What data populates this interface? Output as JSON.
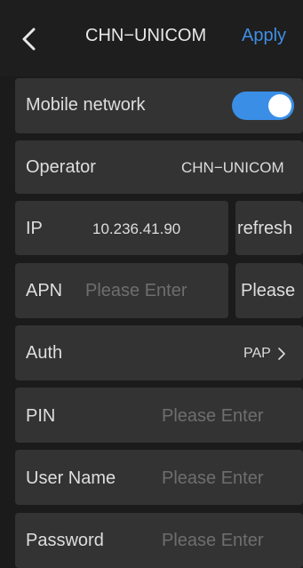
{
  "header": {
    "title": "CHN−UNICOM",
    "apply_label": "Apply"
  },
  "mobile_network": {
    "label": "Mobile network",
    "enabled": true
  },
  "operator": {
    "label": "Operator",
    "value": "CHN−UNICOM"
  },
  "ip": {
    "label": "IP",
    "value": "10.236.41.90",
    "refresh_label": "refresh"
  },
  "apn": {
    "label": "APN",
    "placeholder": "Please Enter",
    "side_placeholder": "Please"
  },
  "auth": {
    "label": "Auth",
    "value": "PAP"
  },
  "pin": {
    "label": "PIN",
    "placeholder": "Please Enter"
  },
  "user_name": {
    "label": "User Name",
    "placeholder": "Please Enter"
  },
  "password": {
    "label": "Password",
    "placeholder": "Please Enter"
  },
  "colors": {
    "accent": "#3a8ee6",
    "card": "#333333",
    "background": "#1b1b1b"
  }
}
